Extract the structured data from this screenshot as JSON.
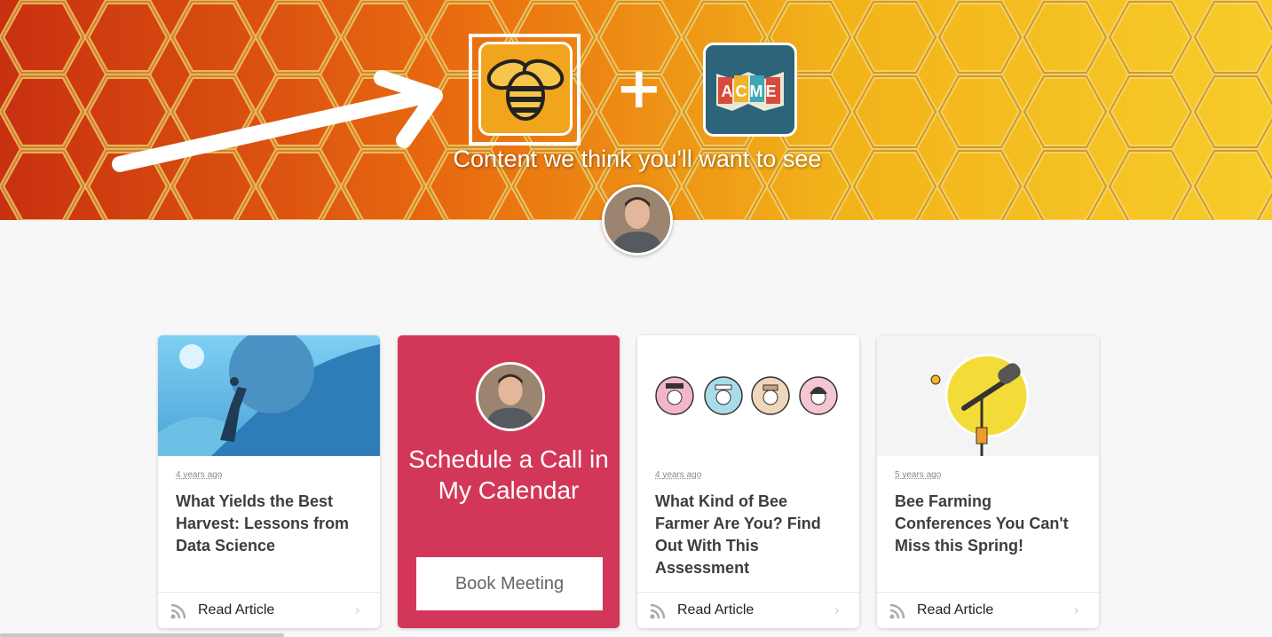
{
  "hero": {
    "title": "Content we think you'll want to see",
    "plus": "+",
    "acme_logo_text": "ACME",
    "colors": {
      "honey": "#e8a018",
      "acme": "#2d6479"
    }
  },
  "cards": [
    {
      "type": "article",
      "age": "4 years ago",
      "title": "What Yields the Best Harvest: Lessons from Data Science",
      "action": "Read Article",
      "image": "climber-pushing-boulder-illustration"
    },
    {
      "type": "cta",
      "title": "Schedule a Call in My Calendar",
      "button": "Book Meeting",
      "color": "#d23759"
    },
    {
      "type": "article",
      "age": "4 years ago",
      "title": "What Kind of Bee Farmer Are You? Find Out With This Assessment",
      "action": "Read Article",
      "image": "four-character-avatars"
    },
    {
      "type": "article",
      "age": "5 years ago",
      "title": "Bee Farming Conferences You Can't Miss this Spring!",
      "action": "Read Article",
      "image": "microphone-with-bee-illustration"
    }
  ],
  "icons": {
    "feed": "rss-icon",
    "chevron": "chevron-right-icon"
  }
}
